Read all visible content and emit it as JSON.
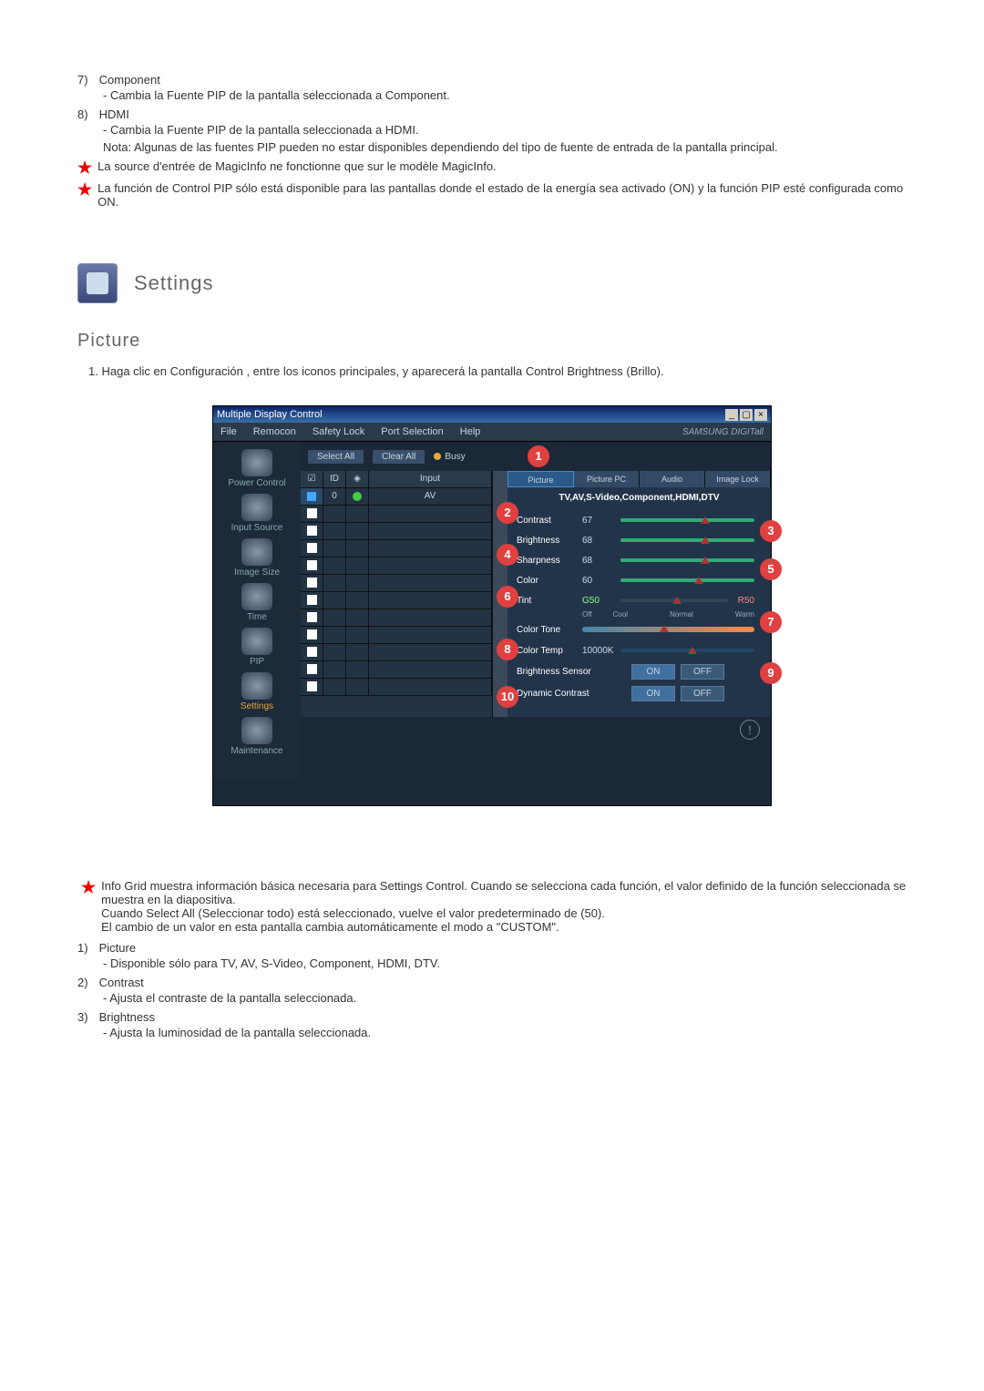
{
  "upper": {
    "item7": {
      "num": "7)",
      "title": "Component",
      "desc": "- Cambia la Fuente PIP de la pantalla seleccionada a Component."
    },
    "item8": {
      "num": "8)",
      "title": "HDMI",
      "desc": "- Cambia la Fuente PIP de la pantalla seleccionada a HDMI.",
      "note": "Nota: Algunas de las fuentes PIP pueden no estar disponibles dependiendo del tipo de fuente de entrada de la pantalla principal."
    },
    "star1": "La source d'entrée de MagicInfo ne fonctionne que sur le modèle MagicInfo.",
    "star2": "La función de Control PIP sólo está disponible para las pantallas donde el estado de la energía sea activado (ON) y la función PIP esté configurada como ON."
  },
  "section": {
    "title": "Settings"
  },
  "subsection": {
    "title": "Picture"
  },
  "step1": "Haga clic en Configuración , entre los iconos principales, y aparecerá la pantalla Control Brightness (Brillo).",
  "app": {
    "title": "Multiple Display Control",
    "menu": [
      "File",
      "Remocon",
      "Safety Lock",
      "Port Selection",
      "Help"
    ],
    "brand": "SAMSUNG DIGITall",
    "toolbar": {
      "selectAll": "Select All",
      "clearAll": "Clear All",
      "busy": "Busy"
    },
    "sidebar": [
      "Power Control",
      "Input Source",
      "Image Size",
      "Time",
      "PIP",
      "Settings",
      "Maintenance"
    ],
    "grid": {
      "cols": [
        "",
        "ID",
        "",
        "Input"
      ],
      "row0": {
        "id": "0",
        "input": "AV"
      }
    },
    "tabs": [
      "Picture",
      "Picture PC",
      "Audio",
      "Image Lock"
    ],
    "panel_sub": "TV,AV,S-Video,Component,HDMI,DTV",
    "rows": {
      "contrast": {
        "label": "Contrast",
        "val": "67"
      },
      "brightness": {
        "label": "Brightness",
        "val": "68"
      },
      "sharpness": {
        "label": "Sharpness",
        "val": "68"
      },
      "color": {
        "label": "Color",
        "val": "60"
      },
      "tint": {
        "label": "Tint",
        "g": "G50",
        "r": "R50"
      },
      "tone": {
        "label": "Color Tone",
        "ticks": [
          "Off",
          "Cool",
          "",
          "Normal",
          "",
          "Warm"
        ]
      },
      "temp": {
        "label": "Color Temp",
        "val": "10000K"
      },
      "bs": {
        "label": "Brightness Sensor",
        "on": "ON",
        "off": "OFF"
      },
      "dc": {
        "label": "Dynamic Contrast",
        "on": "ON",
        "off": "OFF"
      }
    }
  },
  "lower": {
    "star": "Info Grid muestra información básica necesaria para Settings Control. Cuando se selecciona cada función, el valor definido de la función seleccionada se muestra en la diapositiva.",
    "star_l2": "Cuando Select All (Seleccionar todo) está seleccionado, vuelve el valor predeterminado de (50).",
    "star_l3": "El cambio de un valor en esta pantalla cambia automáticamente el modo a \"CUSTOM\".",
    "i1": {
      "num": "1)",
      "title": "Picture",
      "desc": "- Disponible sólo para TV, AV, S-Video, Component, HDMI, DTV."
    },
    "i2": {
      "num": "2)",
      "title": "Contrast",
      "desc": "- Ajusta el contraste de la pantalla seleccionada."
    },
    "i3": {
      "num": "3)",
      "title": "Brightness",
      "desc": "- Ajusta la luminosidad de la pantalla seleccionada."
    }
  },
  "callouts": [
    "1",
    "2",
    "3",
    "4",
    "5",
    "6",
    "7",
    "8",
    "9",
    "10"
  ]
}
